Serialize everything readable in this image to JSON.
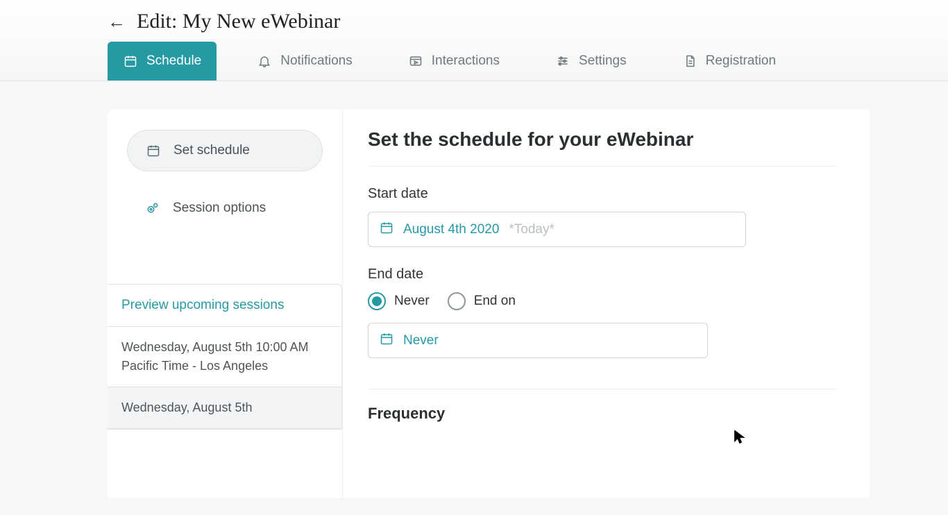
{
  "header": {
    "back_arrow": "←",
    "title": "Edit: My New eWebinar"
  },
  "tabs": [
    {
      "id": "schedule",
      "label": "Schedule",
      "icon": "calendar-icon",
      "active": true
    },
    {
      "id": "notifications",
      "label": "Notifications",
      "icon": "bell-icon",
      "active": false
    },
    {
      "id": "interactions",
      "label": "Interactions",
      "icon": "media-icon",
      "active": false
    },
    {
      "id": "settings",
      "label": "Settings",
      "icon": "sliders-icon",
      "active": false
    },
    {
      "id": "registration",
      "label": "Registration",
      "icon": "document-icon",
      "active": false
    }
  ],
  "sidebar": {
    "items": [
      {
        "id": "set-schedule",
        "label": "Set schedule",
        "icon": "calendar-icon",
        "active": true
      },
      {
        "id": "session-options",
        "label": "Session options",
        "icon": "gear-icon",
        "active": false
      }
    ],
    "preview_title": "Preview upcoming sessions",
    "sessions": [
      "Wednesday, August 5th 10:00 AM Pacific Time - Los Angeles",
      "Wednesday, August 5th"
    ]
  },
  "main": {
    "heading": "Set the schedule for your eWebinar",
    "start_date": {
      "label": "Start date",
      "value": "August 4th 2020",
      "hint": "*Today*"
    },
    "end_date": {
      "label": "End date",
      "options": {
        "never": "Never",
        "end_on": "End on"
      },
      "selected": "never",
      "value": "Never"
    },
    "frequency_label": "Frequency"
  },
  "colors": {
    "accent": "#259aa3"
  }
}
